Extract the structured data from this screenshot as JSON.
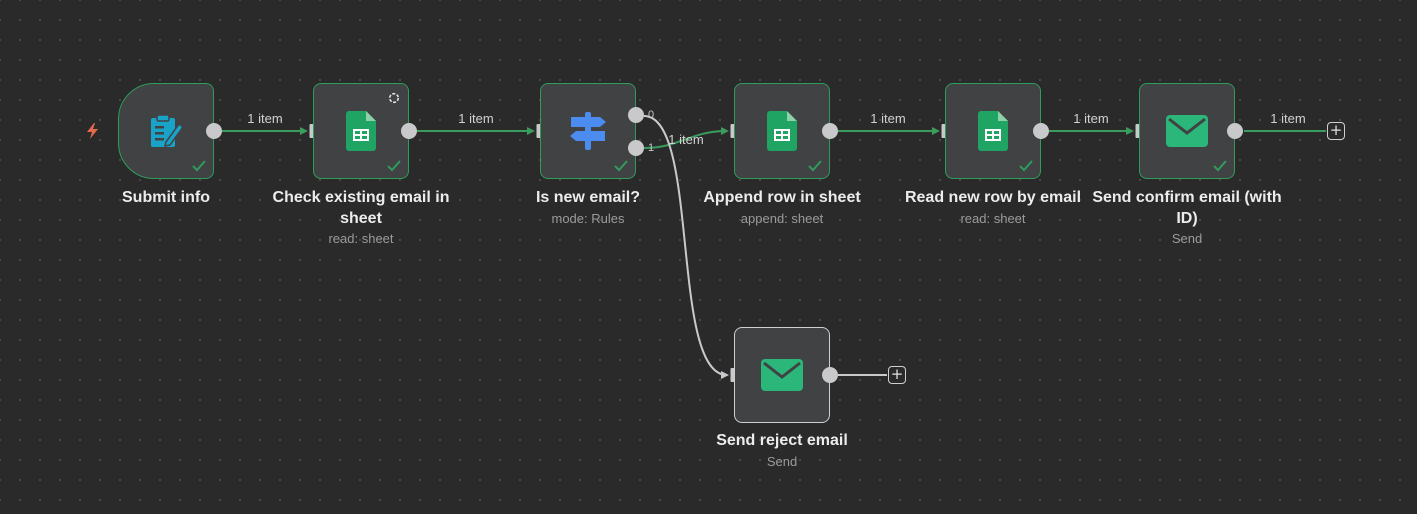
{
  "colors": {
    "canvas": "#2a2a2a",
    "node_fill": "#414244",
    "success_border": "#2f9c5c",
    "success_edge": "#3a9d5d",
    "idle_border": "#cfcfcf",
    "trigger_icon": "#e46a4d",
    "sheets_green": "#1fa463",
    "gmail_green": "#2bb67a",
    "switch_blue": "#4c8cf0"
  },
  "nodes": [
    {
      "id": "submit-info",
      "title": "Submit info",
      "subtitle": "",
      "icon": "form-icon",
      "status": "success"
    },
    {
      "id": "check-existing",
      "title": "Check existing email in sheet",
      "subtitle": "read: sheet",
      "icon": "google-sheets-icon",
      "status": "success"
    },
    {
      "id": "is-new-email",
      "title": "Is new email?",
      "subtitle": "mode: Rules",
      "icon": "signpost-icon",
      "status": "success"
    },
    {
      "id": "append-row",
      "title": "Append row in sheet",
      "subtitle": "append: sheet",
      "icon": "google-sheets-icon",
      "status": "success"
    },
    {
      "id": "read-new-row",
      "title": "Read new row by email",
      "subtitle": "read: sheet",
      "icon": "google-sheets-icon",
      "status": "success"
    },
    {
      "id": "send-confirm",
      "title": "Send confirm email (with ID)",
      "subtitle": "Send",
      "icon": "mail-icon",
      "status": "success"
    },
    {
      "id": "send-reject",
      "title": "Send reject email",
      "subtitle": "Send",
      "icon": "mail-icon",
      "status": "idle"
    }
  ],
  "edges": [
    {
      "from": "submit-info",
      "to": "check-existing",
      "label": "1 item"
    },
    {
      "from": "check-existing",
      "to": "is-new-email",
      "label": "1 item"
    },
    {
      "from": "is-new-email",
      "to": "append-row",
      "label": "1 item",
      "output": "1"
    },
    {
      "from": "is-new-email",
      "to": "send-reject",
      "label": "",
      "output": "0"
    },
    {
      "from": "append-row",
      "to": "read-new-row",
      "label": "1 item"
    },
    {
      "from": "read-new-row",
      "to": "send-confirm",
      "label": "1 item"
    },
    {
      "from": "send-confirm",
      "to": "",
      "label": "1 item"
    }
  ],
  "switch_outputs": [
    "0",
    "1"
  ]
}
